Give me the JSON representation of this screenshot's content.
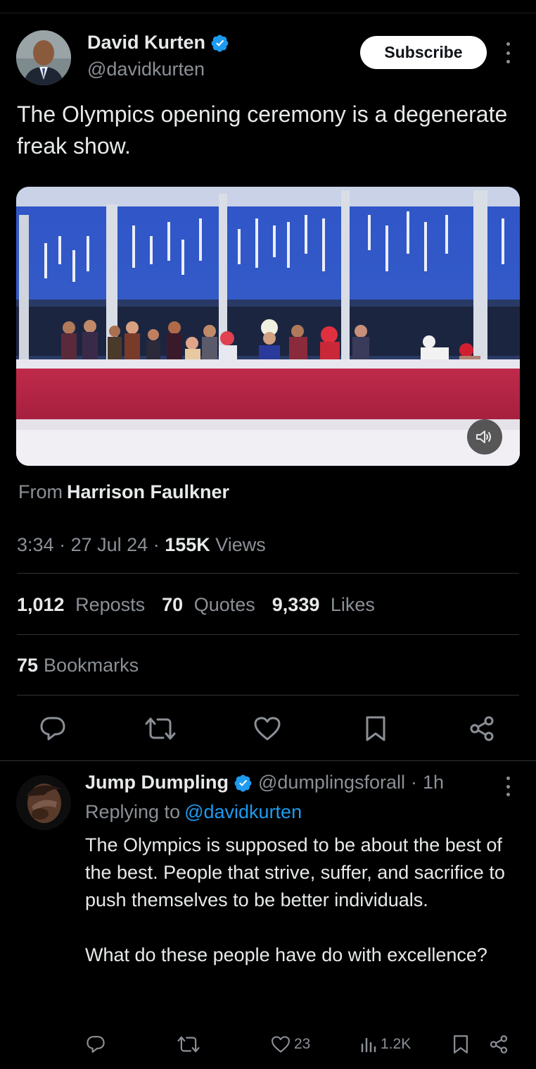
{
  "tweet": {
    "author_name": "David Kurten",
    "author_handle": "@davidkurten",
    "subscribe_label": "Subscribe",
    "text": "The Olympics opening ceremony is a degenerate freak show.",
    "from_prefix": "From",
    "from_name": "Harrison Faulkner",
    "time": "3:34",
    "date": "27 Jul 24",
    "views_count": "155K",
    "views_label": "Views",
    "reposts_count": "1,012",
    "reposts_label": "Reposts",
    "quotes_count": "70",
    "quotes_label": "Quotes",
    "likes_count": "9,339",
    "likes_label": "Likes",
    "bookmarks_count": "75",
    "bookmarks_label": "Bookmarks"
  },
  "reply": {
    "author_name": "Jump Dumpling",
    "author_handle": "@dumplingsforall",
    "age": "1h",
    "replying_prefix": "Replying to",
    "replying_to": "@davidkurten",
    "paragraph1": "The Olympics is supposed to be about the best of the best. People that strive, suffer, and sacrifice to push themselves to be better individuals.",
    "paragraph2": "What do these people have do with excellence?",
    "likes": "23",
    "views": "1.2K"
  },
  "icons": {
    "verified": "verified-badge-icon",
    "more": "more-dots-icon",
    "sound": "speaker-icon",
    "reply": "reply-icon",
    "repost": "repost-icon",
    "like": "heart-icon",
    "bookmark": "bookmark-icon",
    "share": "share-icon",
    "views": "views-bar-icon"
  },
  "colors": {
    "background": "#000000",
    "text": "#e7e9ea",
    "muted": "#8b9096",
    "link": "#1d9bf0",
    "verified": "#1d9bf0",
    "divider": "#2f3336"
  }
}
